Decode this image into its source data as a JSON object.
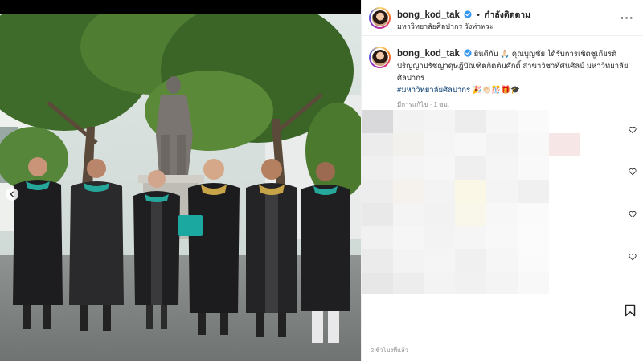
{
  "post": {
    "username": "bong_kod_tak",
    "follow_label": "กำลังติดตาม",
    "location": "มหาวิทยาลัยศิลปากร วังท่าพระ",
    "caption_text": "ยินดีกับ 🙏🏻 คุณบุญชัย ได้รับการเชิดชูเกียรติ ปริญญาปรัชญาดุษฎีบัณฑิตกิตติมศักดิ์ สาขาวิชาทัศนศิลป์ มหาวิทยาลัยศิลปากร",
    "hashtag": "#มหาวิทยาลัยศิลปากร",
    "emojis": "🎉👏🏻🎊🎁🎓",
    "edited_label": "มีการแก้ไข · 1 ชม.",
    "time_ago": "2 ชั่วโมงที่แล้ว"
  },
  "icons": {
    "more": "more-options-icon",
    "verified": "verified-badge-icon",
    "heart": "heart-icon",
    "save": "bookmark-icon",
    "prev": "chevron-left-icon"
  },
  "colors": {
    "verified": "#3897f0",
    "hashtag": "#00376b",
    "muted": "#8e8e8e"
  }
}
